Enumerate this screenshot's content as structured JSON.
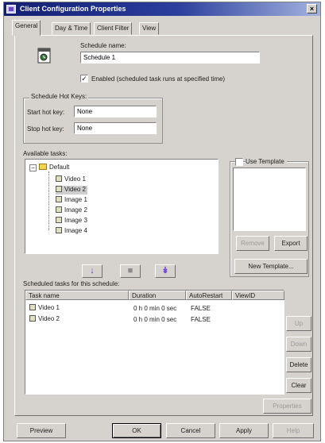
{
  "window": {
    "title": "Client Configuration Properties",
    "close_glyph": "×"
  },
  "tabs": [
    {
      "label": "General",
      "active": true
    },
    {
      "label": "Day & Time",
      "active": false
    },
    {
      "label": "Client Filter",
      "active": false
    },
    {
      "label": "View",
      "active": false
    }
  ],
  "schedule": {
    "name_label": "Schedule name:",
    "name_value": "Schedule 1",
    "enabled_label": "Enabled (scheduled task runs at specified time)",
    "enabled_checked": true,
    "check_glyph": "✓"
  },
  "hotkeys": {
    "group_label": "Schedule Hot Keys:",
    "start_label": "Start hot key:",
    "start_value": "None",
    "stop_label": "Stop hot key:",
    "stop_value": "None"
  },
  "available": {
    "label": "Available tasks:",
    "root": {
      "label": "Default",
      "expander": "−"
    },
    "items": [
      "Video 1",
      "Video 2",
      "Image 1",
      "Image 2",
      "Image 3",
      "Image 4"
    ],
    "selected": "Video 2"
  },
  "template": {
    "use_label": "Use Template",
    "use_checked": false,
    "remove_label": "Remove",
    "export_label": "Export",
    "new_label": "New Template..."
  },
  "move_buttons": {
    "add_glyph": "↓",
    "stop_glyph": "■",
    "add_all_glyph": "↡"
  },
  "scheduled": {
    "label": "Scheduled tasks for this schedule:",
    "columns": [
      "Task name",
      "Duration",
      "AutoRestart",
      "ViewID"
    ],
    "rows": [
      {
        "name": "Video 1",
        "duration": "0 h 0 min 0 sec",
        "autorestart": "FALSE",
        "viewid": ""
      },
      {
        "name": "Video 2",
        "duration": "0 h 0 min 0 sec",
        "autorestart": "FALSE",
        "viewid": ""
      }
    ]
  },
  "side_buttons": {
    "up": "Up",
    "down": "Down",
    "delete": "Delete",
    "clear": "Clear",
    "properties": "Properties"
  },
  "footer": {
    "preview": "Preview",
    "ok": "OK",
    "cancel": "Cancel",
    "apply": "Apply",
    "help": "Help"
  },
  "colors": {
    "title_start": "#121e72",
    "title_end": "#a3b3e0",
    "face": "#d6d3ce",
    "arrow_purple": "#6a3fd0"
  }
}
